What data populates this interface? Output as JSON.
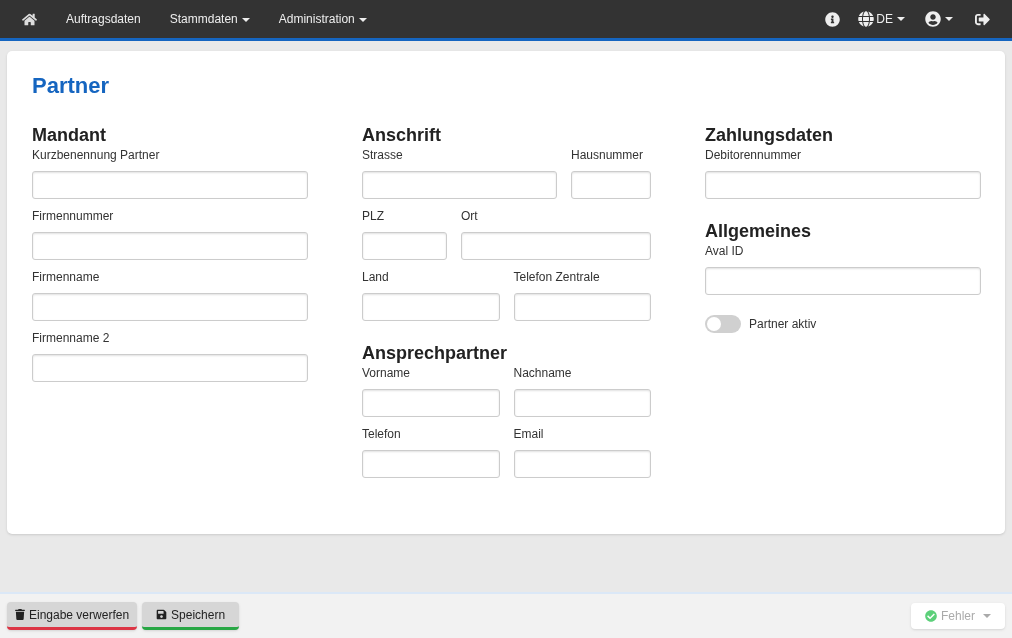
{
  "navbar": {
    "items": [
      {
        "label": "Auftragsdaten",
        "dropdown": false
      },
      {
        "label": "Stammdaten",
        "dropdown": true
      },
      {
        "label": "Administration",
        "dropdown": true
      }
    ],
    "language": "DE"
  },
  "page_title": "Partner",
  "columns": [
    [
      {
        "title": "Mandant",
        "rows": [
          [
            {
              "label": "Kurzbenennung Partner",
              "kind": "full"
            }
          ],
          [
            {
              "label": "Firmennummer",
              "kind": "full"
            }
          ],
          [
            {
              "label": "Firmenname",
              "kind": "full"
            }
          ],
          [
            {
              "label": "Firmenname 2",
              "kind": "full"
            }
          ]
        ]
      }
    ],
    [
      {
        "title": "Anschrift",
        "rows": [
          [
            {
              "label": "Strasse",
              "kind": "wide"
            },
            {
              "label": "Hausnummer",
              "kind": "narrow"
            }
          ],
          [
            {
              "label": "PLZ",
              "kind": "narrow"
            },
            {
              "label": "Ort",
              "kind": "wide"
            }
          ],
          [
            {
              "label": "Land",
              "kind": "half"
            },
            {
              "label": "Telefon Zentrale",
              "kind": "half"
            }
          ]
        ]
      },
      {
        "title": "Ansprechpartner",
        "rows": [
          [
            {
              "label": "Vorname",
              "kind": "half"
            },
            {
              "label": "Nachname",
              "kind": "half"
            }
          ],
          [
            {
              "label": "Telefon",
              "kind": "half"
            },
            {
              "label": "Email",
              "kind": "half"
            }
          ]
        ]
      }
    ],
    [
      {
        "title": "Zahlungsdaten",
        "rows": [
          [
            {
              "label": "Debitorennummer",
              "kind": "full"
            }
          ]
        ]
      },
      {
        "title": "Allgemeines",
        "rows": [
          [
            {
              "label": "Aval ID",
              "kind": "full"
            }
          ]
        ],
        "toggle": {
          "label": "Partner aktiv",
          "on": false
        }
      }
    ]
  ],
  "footer": {
    "discard": "Eingabe verwerfen",
    "save": "Speichern",
    "errors": {
      "label": "Fehler",
      "disabled": true
    }
  }
}
